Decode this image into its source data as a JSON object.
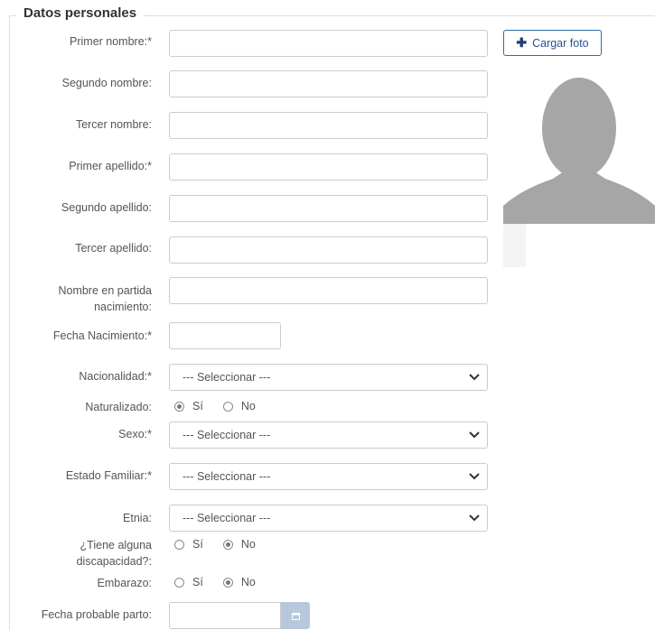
{
  "section_title": "Datos personales",
  "upload_button": {
    "icon": "plus-icon",
    "label": "Cargar foto"
  },
  "fields": {
    "primer_nombre": {
      "label": "Primer nombre:*",
      "value": ""
    },
    "segundo_nombre": {
      "label": "Segundo nombre:",
      "value": ""
    },
    "tercer_nombre": {
      "label": "Tercer nombre:",
      "value": ""
    },
    "primer_apellido": {
      "label": "Primer apellido:*",
      "value": ""
    },
    "segundo_apellido": {
      "label": "Segundo apellido:",
      "value": ""
    },
    "tercer_apellido": {
      "label": "Tercer apellido:",
      "value": ""
    },
    "nombre_partida": {
      "label_line1": "Nombre en partida",
      "label_line2": "nacimiento:",
      "value": ""
    },
    "fecha_nacimiento": {
      "label": "Fecha Nacimiento:*",
      "value": ""
    },
    "nacionalidad": {
      "label": "Nacionalidad:*",
      "selected": "--- Seleccionar ---"
    },
    "naturalizado": {
      "label": "Naturalizado:",
      "options": [
        "Sí",
        "No"
      ],
      "selected": "Sí"
    },
    "sexo": {
      "label": "Sexo:*",
      "selected": "--- Seleccionar ---"
    },
    "estado_familiar": {
      "label": "Estado Familiar:*",
      "selected": "--- Seleccionar ---"
    },
    "etnia": {
      "label": "Etnia:",
      "selected": "--- Seleccionar ---"
    },
    "discapacidad": {
      "label_line1": "¿Tiene alguna",
      "label_line2": "discapacidad?:",
      "options": [
        "Sí",
        "No"
      ],
      "selected": "No"
    },
    "embarazo": {
      "label": "Embarazo:",
      "options": [
        "Sí",
        "No"
      ],
      "selected": "No"
    },
    "fecha_parto": {
      "label": "Fecha probable parto:",
      "value": ""
    }
  },
  "icons": {
    "calendar": "calendar-icon",
    "chevron": "chevron-down-icon",
    "avatar": "avatar-placeholder-icon"
  },
  "colors": {
    "accent": "#2b6cb0",
    "avatar_gray": "#a6a6a6",
    "date_button": "#b8c8dc"
  }
}
